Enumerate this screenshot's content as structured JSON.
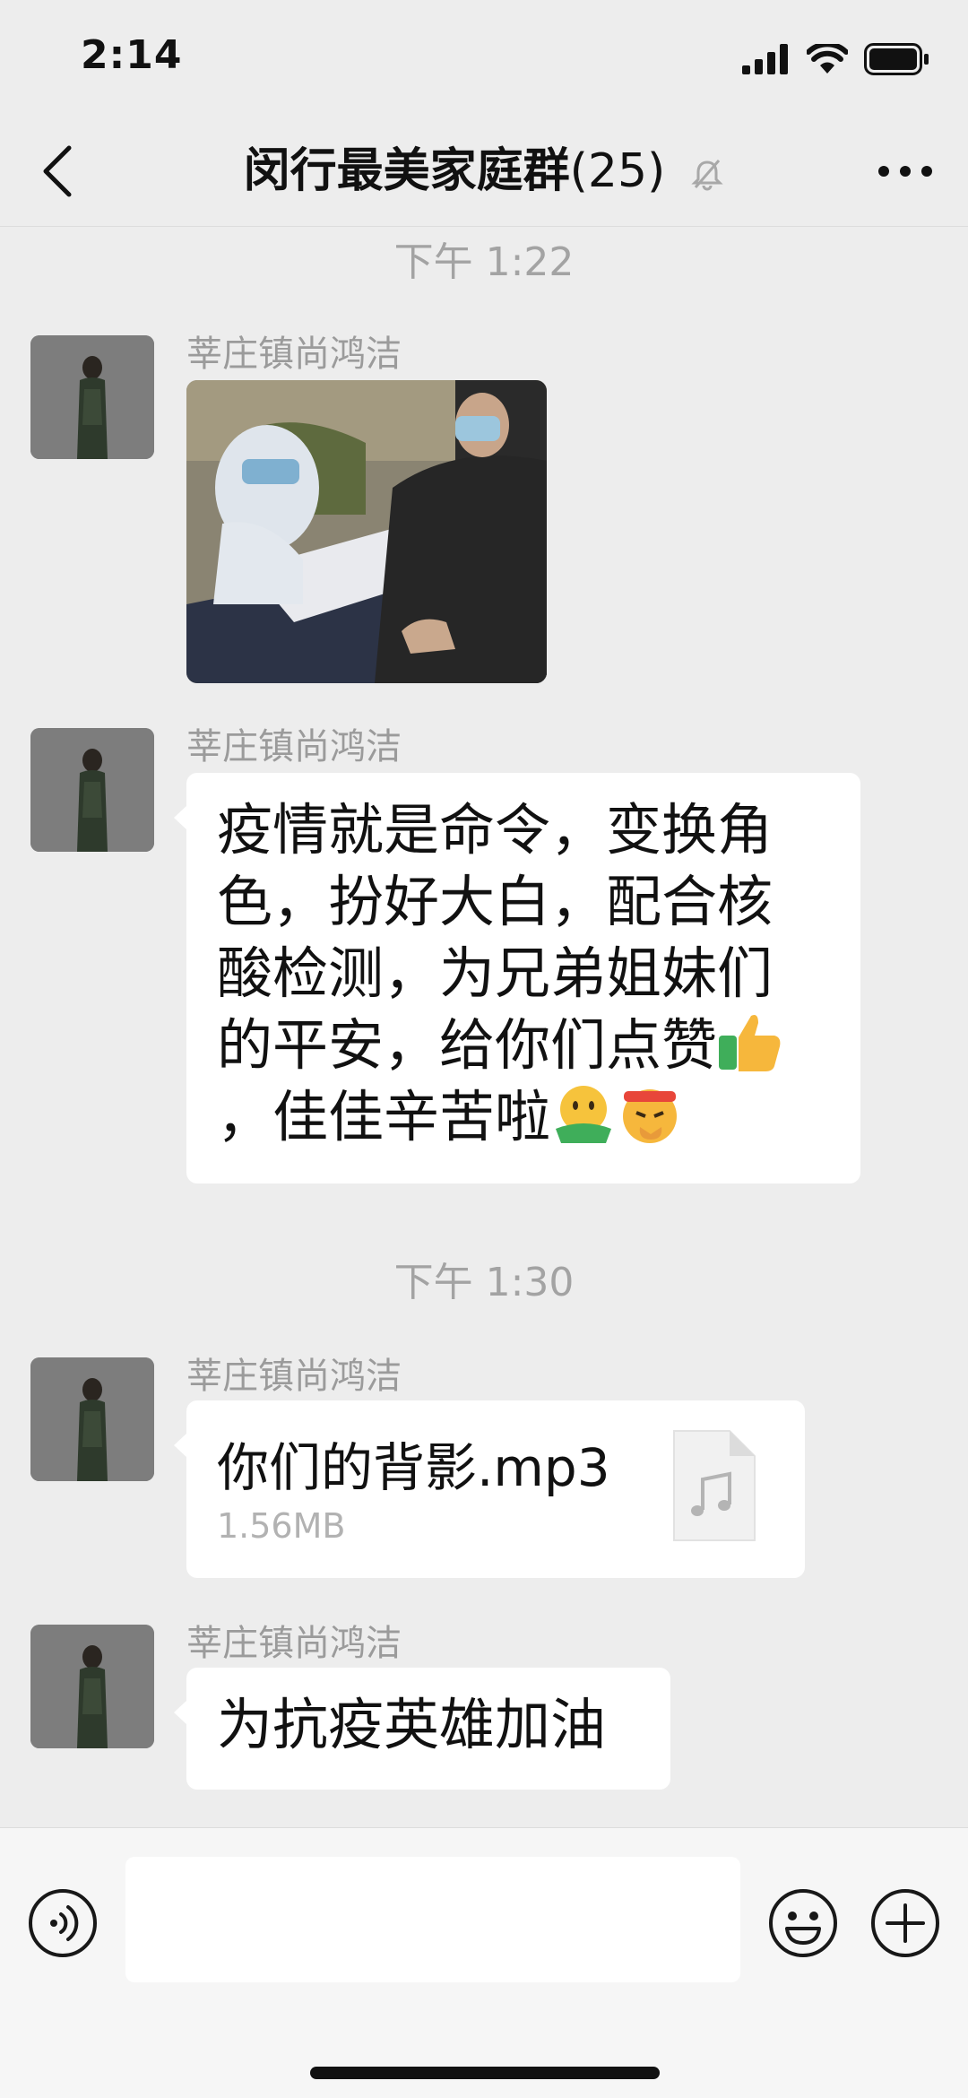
{
  "status_bar": {
    "time": "2:14",
    "icons": [
      "signal-icon",
      "wifi-icon",
      "battery-icon"
    ]
  },
  "nav": {
    "title": "闵行最美家庭群",
    "member_count": "(25)",
    "icons": [
      "back-icon",
      "mute-bell-icon",
      "more-icon"
    ]
  },
  "chat": {
    "messages": [
      {
        "type": "time",
        "text": "下午 1:22"
      },
      {
        "type": "image",
        "sender": "莘庄镇尚鸿洁"
      },
      {
        "type": "text",
        "sender": "莘庄镇尚鸿洁",
        "lines": [
          "疫情就是命令，变换角",
          "色，扮好大白，配合核",
          "酸检测，为兄弟姐妹们",
          "的平安，给你们点赞",
          "，佳佳辛苦啦"
        ],
        "emojis": [
          "thumbs-up-emoji",
          "hug-emoji",
          "shush-emoji"
        ]
      },
      {
        "type": "time",
        "text": "下午 1:30"
      },
      {
        "type": "file",
        "sender": "莘庄镇尚鸿洁",
        "file_name": "你们的背影.mp3",
        "file_size": "1.56MB",
        "icon": "music-file-icon"
      },
      {
        "type": "text",
        "sender": "莘庄镇尚鸿洁",
        "lines": [
          "为抗疫英雄加油"
        ]
      }
    ]
  },
  "input_bar": {
    "placeholder": "",
    "icons": [
      "voice-icon",
      "emoji-icon",
      "plus-icon"
    ]
  },
  "colors": {
    "background": "#ededed",
    "bubble": "#ffffff",
    "meta_text": "#9b9b9b"
  }
}
